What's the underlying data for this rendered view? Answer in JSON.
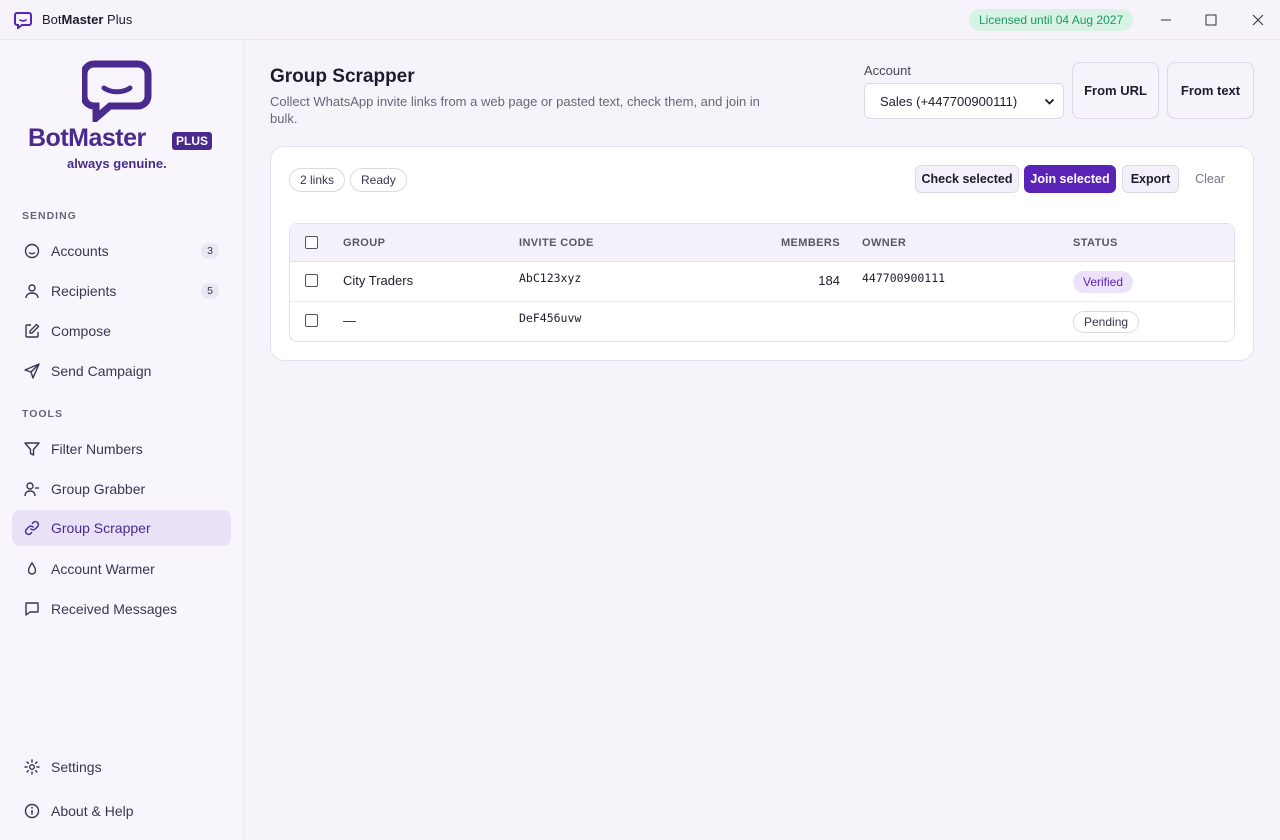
{
  "app": {
    "title_prefix": "Bot",
    "title_bold": "Master",
    "title_suffix": " Plus",
    "license": "Licensed until 04 Aug 2027"
  },
  "brand": {
    "name": "BotMaster",
    "badge": "PLUS",
    "tagline": "always genuine.",
    "accent": "#4a2a8c"
  },
  "sidebar": {
    "sending_label": "SENDING",
    "tools_label": "TOOLS",
    "sending": [
      {
        "label": "Accounts",
        "badge": "3",
        "icon": "smile-icon"
      },
      {
        "label": "Recipients",
        "badge": "5",
        "icon": "user-icon"
      },
      {
        "label": "Compose",
        "icon": "edit-icon"
      },
      {
        "label": "Send Campaign",
        "icon": "send-icon"
      }
    ],
    "tools": [
      {
        "label": "Filter Numbers",
        "icon": "filter-icon"
      },
      {
        "label": "Group Grabber",
        "icon": "user-minus-icon"
      },
      {
        "label": "Group Scrapper",
        "icon": "link-icon",
        "active": true
      },
      {
        "label": "Account Warmer",
        "icon": "droplet-icon"
      },
      {
        "label": "Received Messages",
        "icon": "message-icon"
      }
    ],
    "footer": [
      {
        "label": "Settings",
        "icon": "gear-icon"
      },
      {
        "label": "About & Help",
        "icon": "info-icon"
      }
    ]
  },
  "page": {
    "title": "Group Scrapper",
    "subtitle": "Collect WhatsApp invite links from a web page or pasted text, check them, and join in bulk.",
    "account_label": "Account",
    "account_value": "Sales (+447700900111)",
    "from_url": "From URL",
    "from_text": "From text"
  },
  "panel": {
    "links_chip": "2 links",
    "status_chip": "Ready",
    "check_selected": "Check selected",
    "join_selected": "Join selected",
    "export": "Export",
    "clear": "Clear"
  },
  "table": {
    "columns": [
      "GROUP",
      "INVITE CODE",
      "MEMBERS",
      "OWNER",
      "STATUS"
    ],
    "rows": [
      {
        "group": "City Traders",
        "code": "AbC123xyz",
        "members": "184",
        "owner": "447700900111",
        "status": "Verified"
      },
      {
        "group": "—",
        "code": "DeF456uvw",
        "members": "",
        "owner": "",
        "status": "Pending"
      }
    ]
  }
}
